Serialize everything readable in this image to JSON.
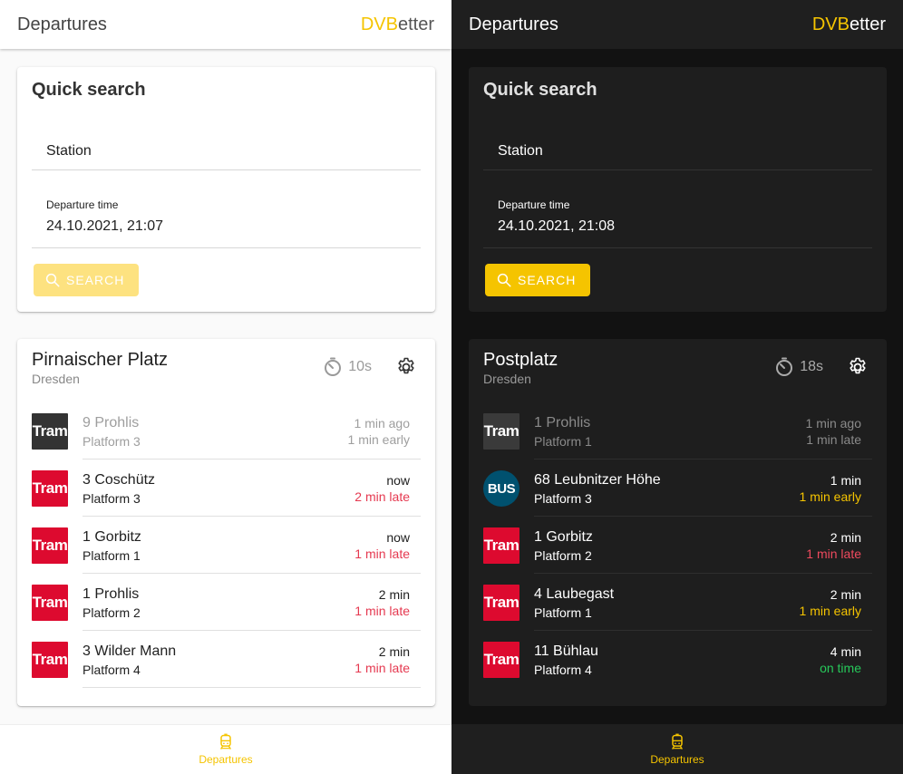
{
  "colors": {
    "accent": "#f5c400",
    "tram": "#dd0a2f",
    "bus": "#00516f",
    "late": "#e53950",
    "on_time": "#27c85a"
  },
  "light": {
    "appbar": {
      "title": "Departures",
      "brand_accent": "DVB",
      "brand_rest": "etter"
    },
    "search": {
      "title": "Quick search",
      "station_value": "Station",
      "time_label": "Departure time",
      "time_value": "24.10.2021, 21:07",
      "button_label": "SEARCH"
    },
    "station": {
      "name": "Pirnaischer Platz",
      "city": "Dresden",
      "timer": "10s",
      "departures": [
        {
          "badge": "Tram",
          "line": "9 Prohlis",
          "platform": "Platform 3",
          "time": "1 min ago",
          "delay": "1 min early"
        },
        {
          "badge": "Tram",
          "line": "3 Coschütz",
          "platform": "Platform 3",
          "time": "now",
          "delay": "2 min late"
        },
        {
          "badge": "Tram",
          "line": "1 Gorbitz",
          "platform": "Platform 1",
          "time": "now",
          "delay": "1 min late"
        },
        {
          "badge": "Tram",
          "line": "1 Prohlis",
          "platform": "Platform 2",
          "time": "2 min",
          "delay": "1 min late"
        },
        {
          "badge": "Tram",
          "line": "3 Wilder Mann",
          "platform": "Platform 4",
          "time": "2 min",
          "delay": "1 min late"
        }
      ]
    },
    "bottomnav": {
      "label": "Departures",
      "icon": "train-icon"
    }
  },
  "dark": {
    "appbar": {
      "title": "Departures",
      "brand_accent": "DVB",
      "brand_rest": "etter"
    },
    "search": {
      "title": "Quick search",
      "station_value": "Station",
      "time_label": "Departure time",
      "time_value": "24.10.2021, 21:08",
      "button_label": "SEARCH"
    },
    "station": {
      "name": "Postplatz",
      "city": "Dresden",
      "timer": "18s",
      "departures": [
        {
          "badge": "Tram",
          "line": "1 Prohlis",
          "platform": "Platform 1",
          "time": "1 min ago",
          "delay": "1 min late"
        },
        {
          "badge": "BUS",
          "line": "68 Leubnitzer Höhe",
          "platform": "Platform 3",
          "time": "1 min",
          "delay": "1 min early"
        },
        {
          "badge": "Tram",
          "line": "1 Gorbitz",
          "platform": "Platform 2",
          "time": "2 min",
          "delay": "1 min late"
        },
        {
          "badge": "Tram",
          "line": "4 Laubegast",
          "platform": "Platform 1",
          "time": "2 min",
          "delay": "1 min early"
        },
        {
          "badge": "Tram",
          "line": "11 Bühlau",
          "platform": "Platform 4",
          "time": "4 min",
          "delay": "on time"
        }
      ]
    },
    "bottomnav": {
      "label": "Departures",
      "icon": "train-icon"
    }
  }
}
